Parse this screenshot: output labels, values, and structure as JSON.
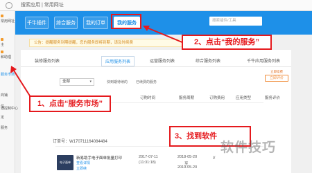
{
  "browser": {
    "address": "搜索应用 | 常用网址"
  },
  "sidebar": {
    "items": [
      {
        "label": "常用网址"
      },
      {
        "label": "主"
      },
      {
        "label": "和助理"
      },
      {
        "label": "服务市场"
      },
      {
        "label": "商铺"
      },
      {
        "label": "信"
      },
      {
        "label": "定"
      },
      {
        "label": "服务"
      },
      {
        "label": "通控制中心"
      }
    ]
  },
  "header": {
    "tabs": [
      {
        "label": "千牛插件"
      },
      {
        "label": "综合服务"
      },
      {
        "label": "我的订单"
      },
      {
        "label": "我的服务"
      }
    ],
    "search_placeholder": "搜索插件/工具"
  },
  "notice": "公告：提醒服务到期提醒，您的服务即将到期，请及时续费",
  "subtabs": [
    {
      "label": "装修服务列表"
    },
    {
      "label": "应用服务列表"
    },
    {
      "label": "运营服务列表"
    },
    {
      "label": "综合服务列表"
    },
    {
      "label": "千牛应用服务列表"
    }
  ],
  "filter": {
    "selected": "全部",
    "options": [
      "快到期待续的",
      "已续费的服务"
    ]
  },
  "table": {
    "headers": [
      "订购时间",
      "服务周期",
      "订购费用",
      "应用类型",
      "服务评价"
    ],
    "order_no": "订单号：W170711164084484",
    "row": {
      "thumb_label": "电子面单",
      "name": "新易助手电子面单批量打印",
      "sub1": "查看详情",
      "sub2": "立即续",
      "order_time_1": "2017-07-11",
      "order_time_2": "(11:31:18)",
      "period_1": "2018-05-20",
      "period_2": "至",
      "period_3": "2019-05-20",
      "fee": "￥"
    },
    "renew_top": "立即续费",
    "renew_btn": "立即评价"
  },
  "annotations": {
    "step1": "1、点击“服务市场”",
    "step2": "2、点击“我的服务”",
    "step3": "3、找到软件"
  },
  "watermark": "软件技巧",
  "colors": {
    "header_blue": "#1e90e8",
    "annotation_red": "#e5191d",
    "notice_orange": "#d48a1e"
  }
}
